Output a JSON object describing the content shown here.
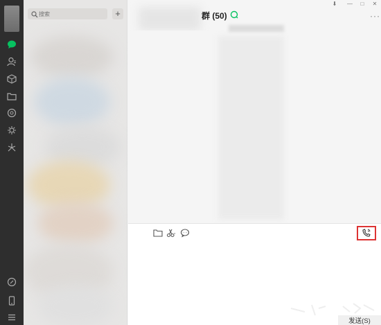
{
  "sidebar": {
    "icons": [
      "chat-icon",
      "contacts-icon",
      "favorites-icon",
      "files-icon",
      "moments-icon",
      "mini-programs-icon",
      "channels-icon",
      "phone-icon",
      "mobile-icon",
      "menu-icon"
    ]
  },
  "contacts_panel": {
    "search": {
      "placeholder": "搜索",
      "value": ""
    },
    "add_label": "+"
  },
  "chat": {
    "title": "群 (50)",
    "more_label": "···",
    "window_controls": [
      "⬇",
      "—",
      "□",
      "✕"
    ]
  },
  "composer": {
    "tools": [
      "folder-icon",
      "scissors-icon",
      "chat-history-icon"
    ],
    "call_icon": "group-call-icon",
    "send_label": "发送(S)"
  },
  "colors": {
    "rail": "#2e2e2e",
    "accent_green": "#07c160",
    "highlight_red": "#d33333"
  }
}
